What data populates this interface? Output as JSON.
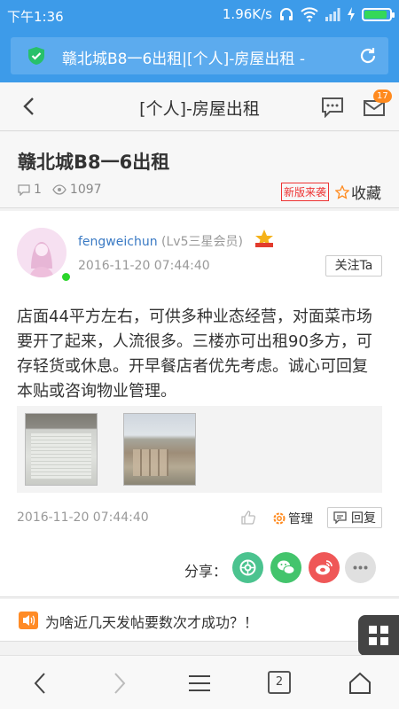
{
  "status_bar": {
    "time": "下午1:36",
    "net_speed": "1.96K/s",
    "icons": [
      "headphone-icon",
      "wifi-icon",
      "signal-icon",
      "charging-icon",
      "battery-icon"
    ],
    "battery_level": 0.9,
    "battery_color": "#34d858"
  },
  "browser": {
    "url_text": "赣北城B8一6出租|[个人]-房屋出租 -",
    "shield_color": "#27c06a",
    "accent": "#3d9be9"
  },
  "header": {
    "title": "[个人]-房屋出租",
    "mail_badge": "17"
  },
  "thread": {
    "title": "赣北城B8一6出租",
    "reply_count": "1",
    "view_count": "1097",
    "new_version_label": "新版来袭",
    "favorite_label": "收藏"
  },
  "post": {
    "author": "fengweichun",
    "level": "(Lv5三星会员)",
    "time": "2016-11-20 07:44:40",
    "follow_label": "关注Ta",
    "content": "店面44平方左右，可供多种业态经营，对面菜市场要开了起来，人流很多。三楼亦可出租90多方，可存轻货或休息。开早餐店者优先考虑。诚心可回复本贴或咨询物业管理。",
    "footer_time": "2016-11-20 07:44:40",
    "manage_label": "管理",
    "reply_label": "回复",
    "share_label": "分享："
  },
  "notice": {
    "text": "为啥近几天发帖要数次才成功？！"
  },
  "bottom_nav": {
    "tab_count": "2"
  }
}
